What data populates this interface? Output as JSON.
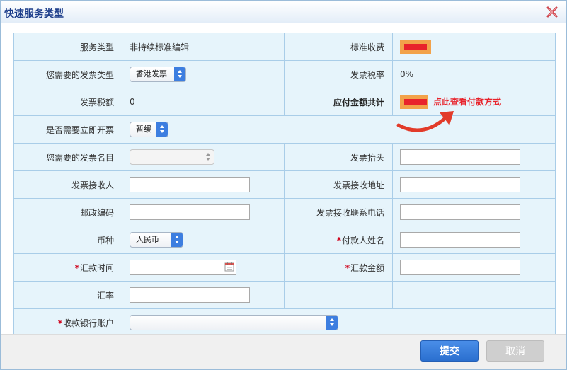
{
  "dialog": {
    "title": "快速服务类型"
  },
  "rows": {
    "service_type": {
      "label": "服务类型",
      "value": "非持续标准编辑"
    },
    "standard_fee": {
      "label": "标准收费"
    },
    "invoice_type": {
      "label": "您需要的发票类型",
      "selected": "香港发票"
    },
    "tax_rate": {
      "label": "发票税率",
      "value": "0%"
    },
    "tax_amount": {
      "label": "发票税额",
      "value": "0"
    },
    "total": {
      "label": "应付金额共计",
      "link": "点此查看付款方式"
    },
    "immediate": {
      "label": "是否需要立即开票",
      "selected": "暂缓"
    },
    "invoice_item": {
      "label": "您需要的发票名目",
      "selected": ""
    },
    "invoice_header": {
      "label": "发票抬头",
      "value": ""
    },
    "recipient": {
      "label": "发票接收人",
      "value": ""
    },
    "address": {
      "label": "发票接收地址",
      "value": ""
    },
    "postcode": {
      "label": "邮政编码",
      "value": ""
    },
    "phone": {
      "label": "发票接收联系电话",
      "value": ""
    },
    "currency": {
      "label": "币种",
      "selected": "人民币"
    },
    "payer_name": {
      "required": "*",
      "label": "付款人姓名",
      "value": ""
    },
    "remit_time": {
      "required": "*",
      "label": "汇款时间",
      "value": ""
    },
    "remit_amount": {
      "required": "*",
      "label": "汇款金额",
      "value": ""
    },
    "exchange_rate": {
      "label": "汇率",
      "value": ""
    },
    "bank_account": {
      "required": "*",
      "label": "收款银行账户",
      "selected": ""
    }
  },
  "footer": {
    "submit": "提交",
    "cancel": "取消"
  },
  "colors": {
    "title": "#1c3d8a",
    "cell_bg": "#e6f4fb",
    "cell_border": "#a9cde8",
    "accent_red": "#e8232b",
    "primary_button": "#2a6fcf"
  },
  "icons": {
    "close": "close-x-icon",
    "calendar": "calendar-icon",
    "arrow": "curved-arrow-icon"
  }
}
